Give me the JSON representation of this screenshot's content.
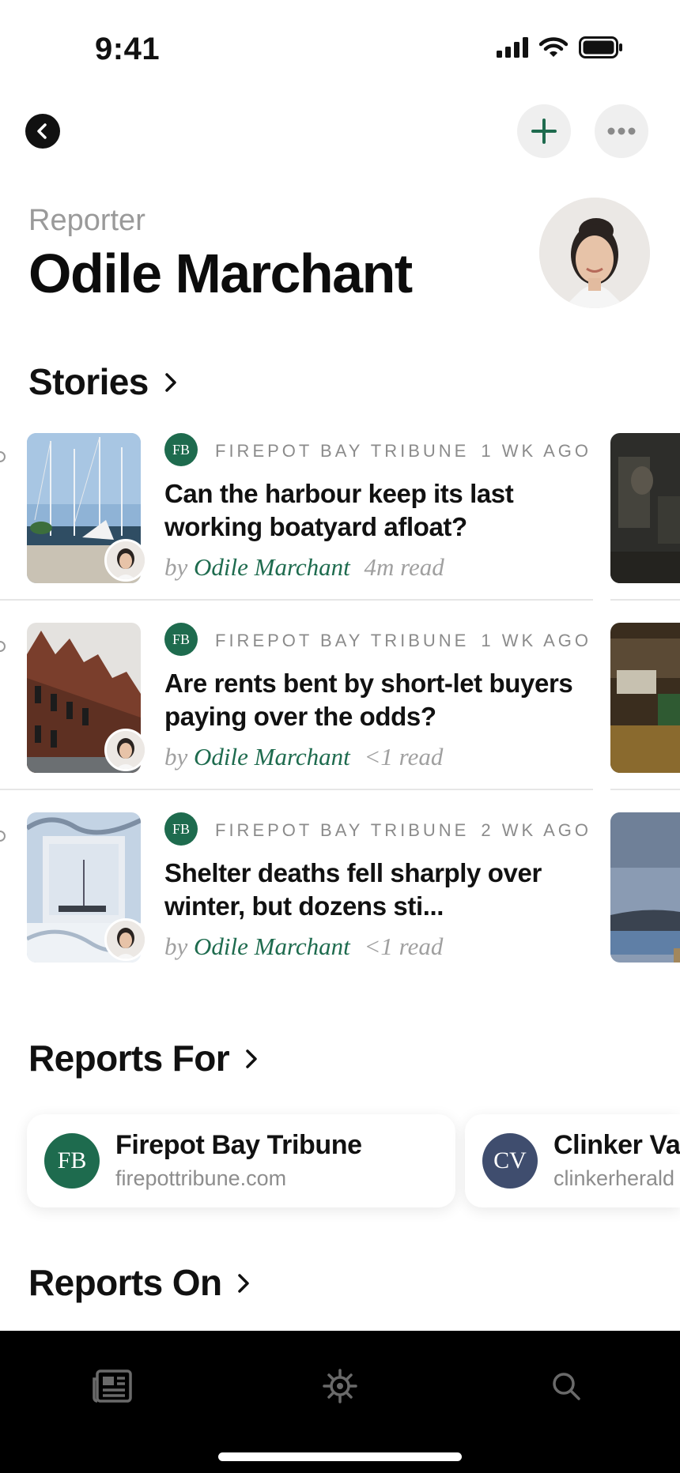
{
  "status_bar": {
    "time": "9:41"
  },
  "nav": {
    "back_icon": "chevron-left-icon",
    "add_icon": "plus-icon",
    "more_icon": "ellipsis-icon"
  },
  "header": {
    "kicker": "Reporter",
    "name": "Odile Marchant"
  },
  "stories_section": {
    "title": "Stories"
  },
  "stories": [
    {
      "publication": "FIREPOT BAY TRIBUNE",
      "badge": "FB",
      "age": "1 WK AGO",
      "title": "Can the harbour keep its last working boatyard afloat?",
      "by": "by",
      "author": "Odile Marchant",
      "read": "4m read"
    },
    {
      "publication": "FIREPOT BAY TRIBUNE",
      "badge": "FB",
      "age": "1 WK AGO",
      "title": "Are rents bent by short-let buyers paying over the odds?",
      "by": "by",
      "author": "Odile Marchant",
      "read": "<1 read"
    },
    {
      "publication": "FIREPOT BAY TRIBUNE",
      "badge": "FB",
      "age": "2 WK AGO",
      "title": "Shelter deaths fell sharply over winter, but dozens sti...",
      "by": "by",
      "author": "Odile Marchant",
      "read": "<1 read"
    }
  ],
  "reports_for": {
    "title": "Reports For",
    "items": [
      {
        "badge": "FB",
        "name": "Firepot Bay Tribune",
        "url": "firepottribune.com",
        "color": "#1e6b4e"
      },
      {
        "badge": "CV",
        "name": "Clinker Val",
        "url": "clinkerherald",
        "color": "#3f4d6e"
      }
    ]
  },
  "reports_on": {
    "title": "Reports On"
  },
  "tab_bar": {
    "tabs": [
      "news-icon",
      "gear-icon",
      "search-icon"
    ]
  },
  "colors": {
    "accent": "#1e6b4e",
    "secondary": "#3f4d6e",
    "tab_bar": "#000000"
  }
}
